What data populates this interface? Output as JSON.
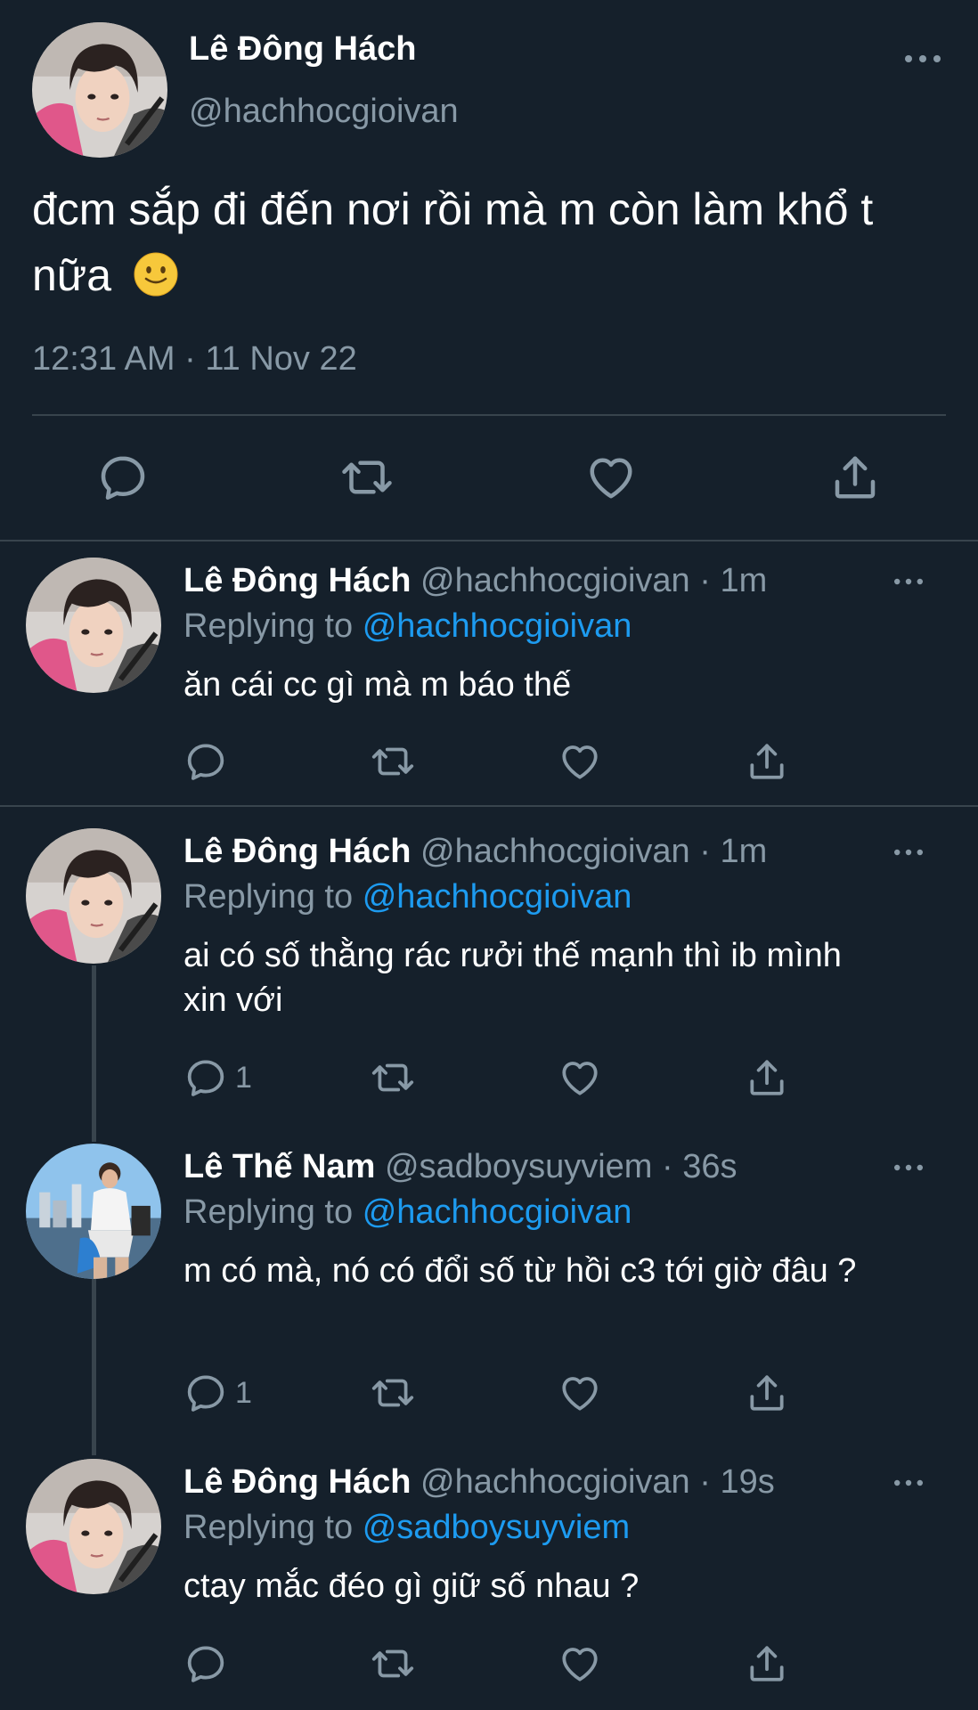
{
  "main_tweet": {
    "name": "Lê Đông Hách",
    "handle": "@hachhocgioivan",
    "text": "đcm sắp đi đến nơi rồi mà m còn làm khổ t nữa",
    "emoji": "slightly-smiling-face-emoji",
    "timestamp": "12:31 AM · 11 Nov 22",
    "actions": [
      "reply-icon",
      "retweet-icon",
      "like-icon",
      "share-icon"
    ]
  },
  "replies": [
    {
      "name": "Lê Đông Hách",
      "handle": "@hachhocgioivan",
      "time": "· 1m",
      "replying_prefix": "Replying to",
      "replying_to": "@hachhocgioivan",
      "text": "ăn cái cc gì mà m báo thế",
      "reply_count": ""
    },
    {
      "name": "Lê Đông Hách",
      "handle": "@hachhocgioivan",
      "time": "· 1m",
      "replying_prefix": "Replying to",
      "replying_to": "@hachhocgioivan",
      "text": "ai có số thằng rác rưởi thế mạnh thì ib mình xin với",
      "reply_count": "1"
    },
    {
      "name": "Lê Thế Nam",
      "handle": "@sadboysuyviem",
      "time": "· 36s",
      "replying_prefix": "Replying to",
      "replying_to": "@hachhocgioivan",
      "text": "m có mà, nó có đổi số từ hồi c3 tới giờ đâu ?",
      "reply_count": "1"
    },
    {
      "name": "Lê Đông Hách",
      "handle": "@hachhocgioivan",
      "time": "· 19s",
      "replying_prefix": "Replying to",
      "replying_to": "@sadboysuyviem",
      "text": "ctay mắc đéo gì giữ số nhau ?",
      "reply_count": ""
    }
  ],
  "colors": {
    "background": "#15202b",
    "text": "#ffffff",
    "secondary": "#8899a6",
    "link": "#1d9bf0",
    "divider": "#38444d"
  }
}
